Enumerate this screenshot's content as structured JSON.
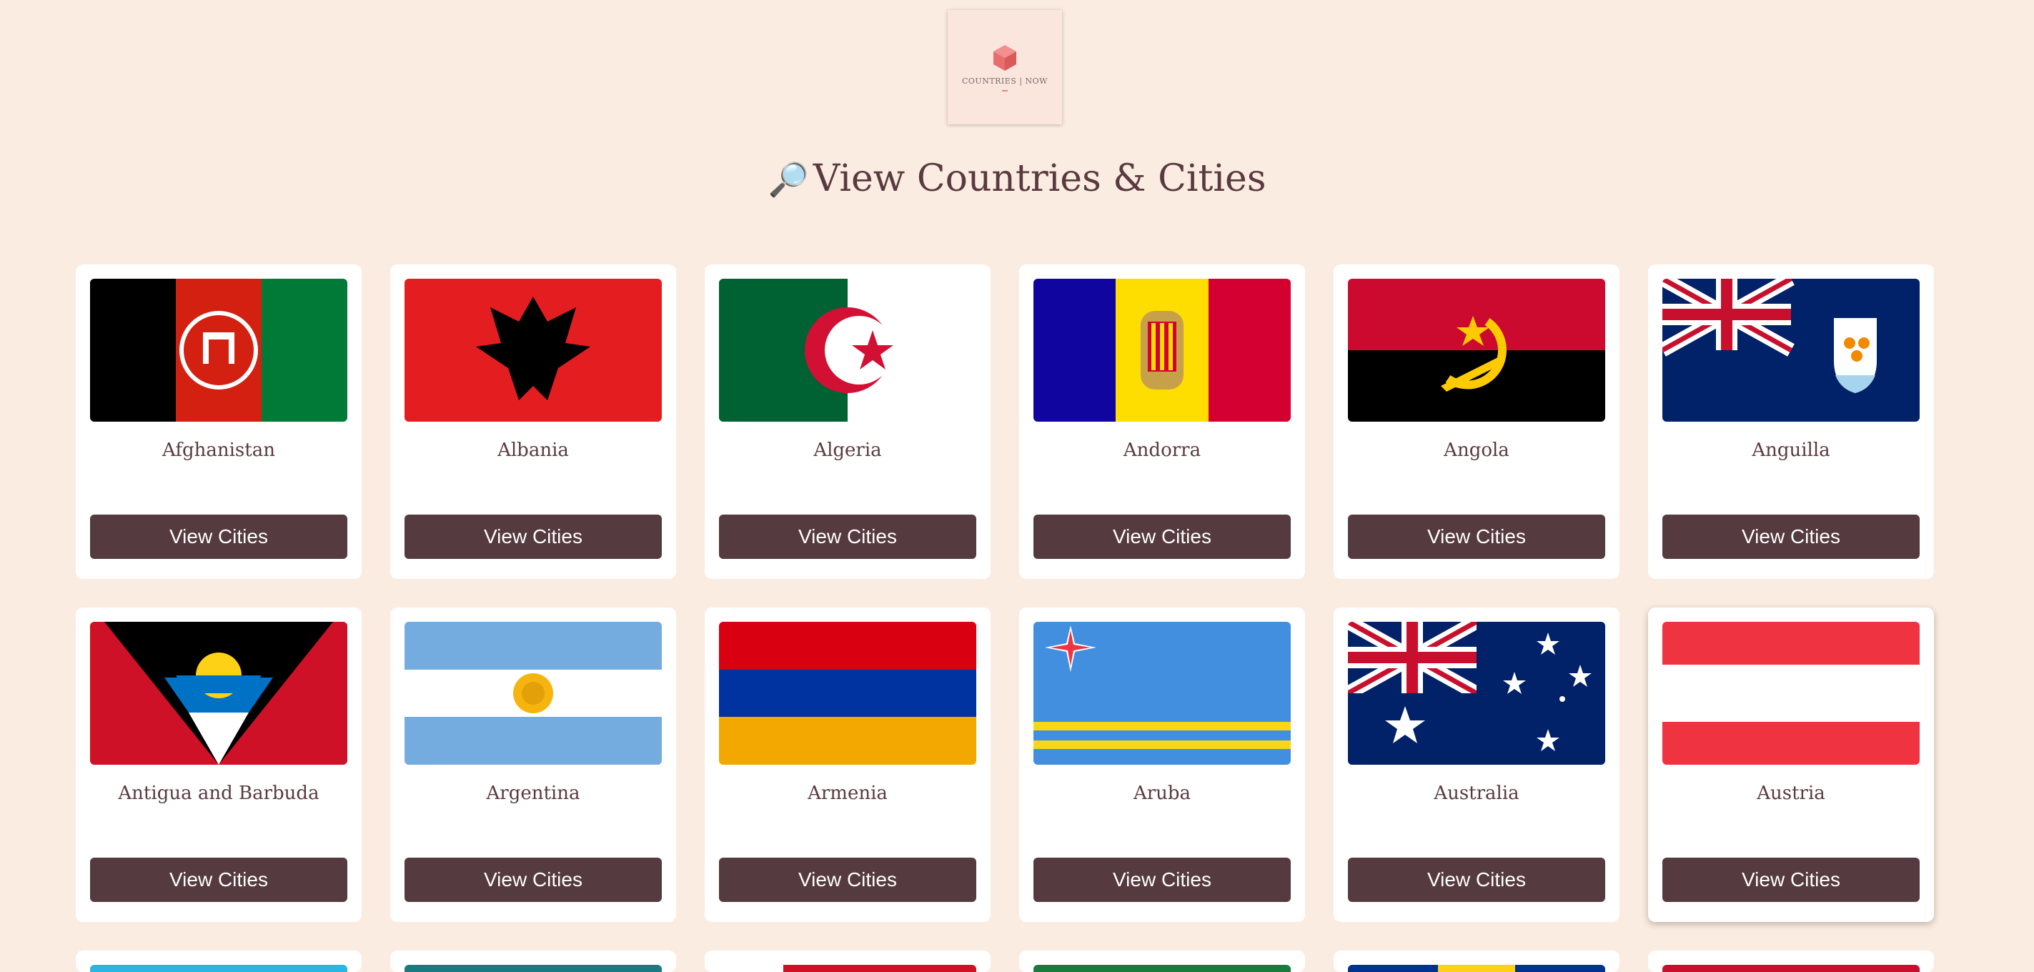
{
  "logo": {
    "brand": "COUNTRIES | NOW"
  },
  "page": {
    "title": "View Countries & Cities",
    "title_icon": "🔎"
  },
  "button_label": "View Cities",
  "countries": [
    {
      "name": "Afghanistan"
    },
    {
      "name": "Albania"
    },
    {
      "name": "Algeria"
    },
    {
      "name": "Andorra"
    },
    {
      "name": "Angola"
    },
    {
      "name": "Anguilla"
    },
    {
      "name": "Antigua and Barbuda"
    },
    {
      "name": "Argentina"
    },
    {
      "name": "Armenia"
    },
    {
      "name": "Aruba"
    },
    {
      "name": "Australia"
    },
    {
      "name": "Austria"
    }
  ]
}
